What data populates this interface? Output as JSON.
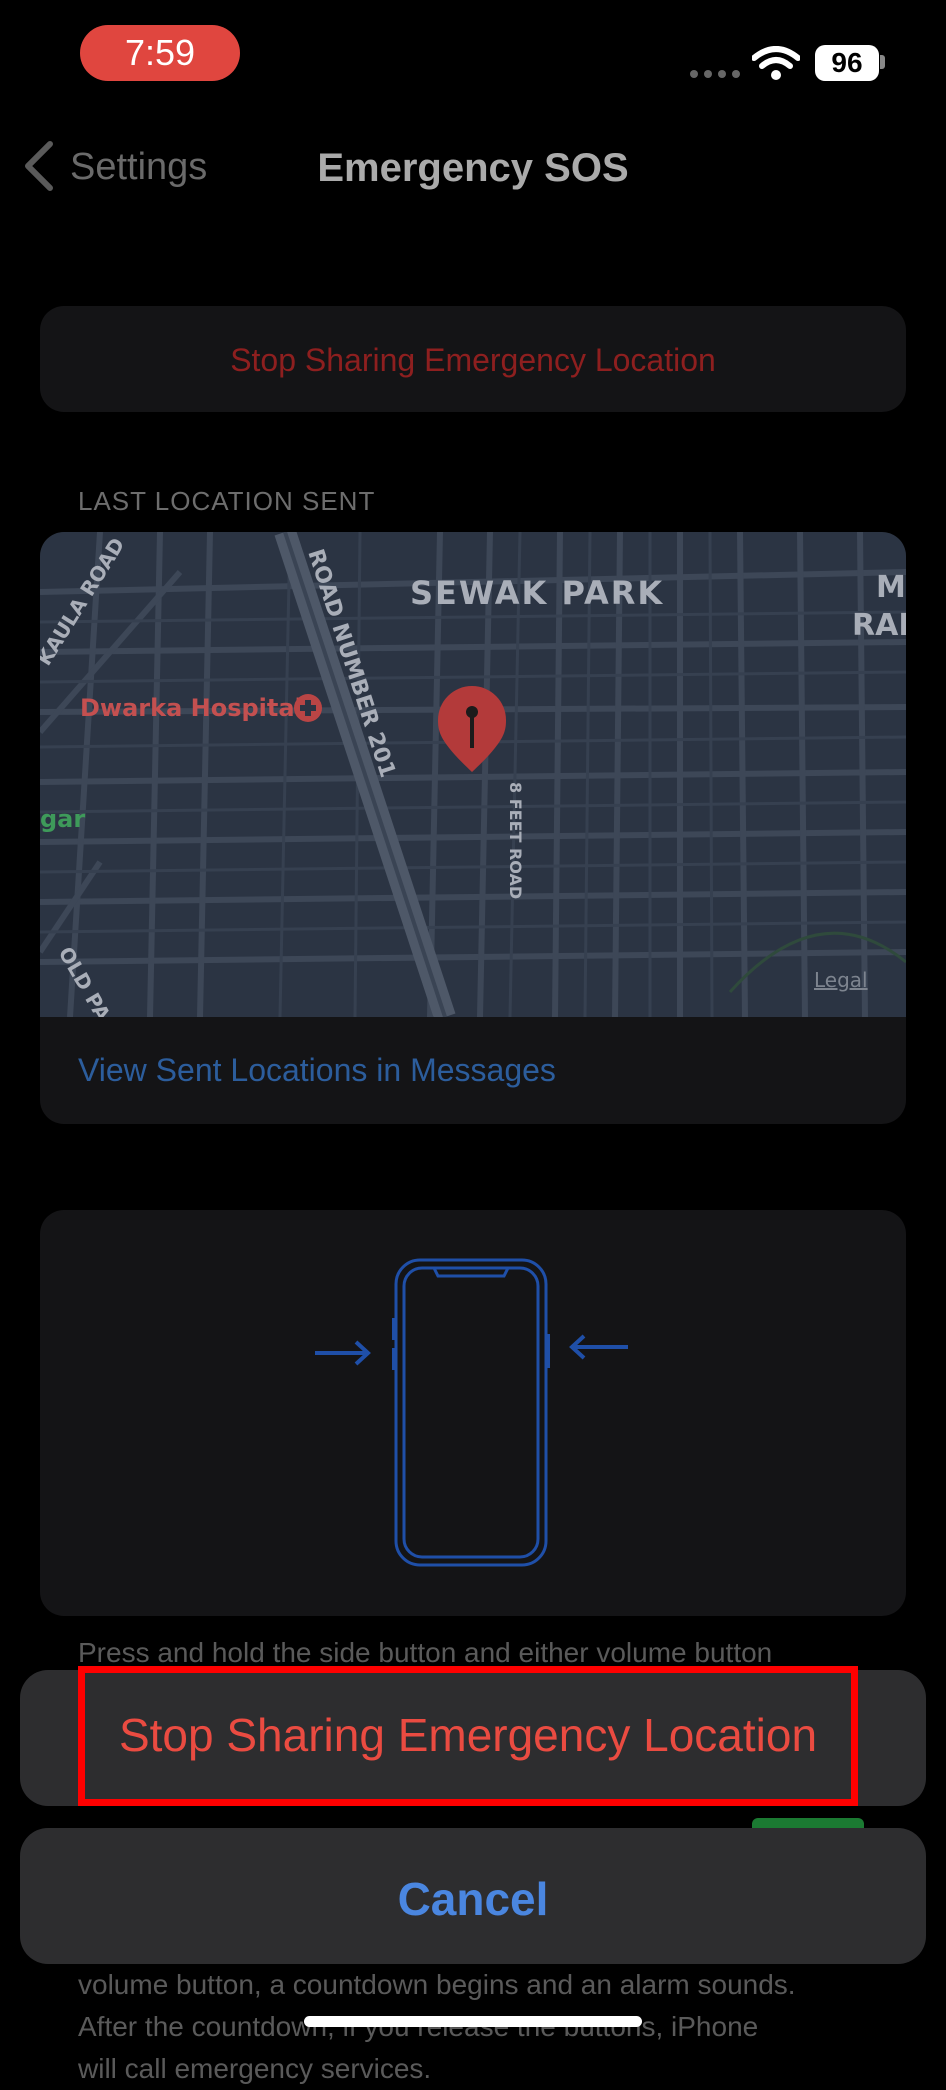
{
  "status_bar": {
    "time": "7:59",
    "battery": "96",
    "wifi_icon": "wifi-icon"
  },
  "nav": {
    "back_label": "Settings",
    "title": "Emergency SOS"
  },
  "stop_sharing_row": {
    "label": "Stop Sharing Emergency Location"
  },
  "last_location": {
    "header": "LAST LOCATION SENT",
    "map": {
      "labels": {
        "sewak_park": "SEWAK PARK",
        "dwarka_hospital": "Dwarka Hospital",
        "road_201": "ROAD NUMBER 201",
        "feet_road": "8 FEET ROAD",
        "kaula_road": "KAULA ROAD",
        "old_pa": "OLD PA",
        "gar": "gar",
        "ma": "MA",
        "ram": "RAM",
        "legal": "Legal"
      }
    },
    "view_link": "View Sent Locations in Messages"
  },
  "footer": {
    "line1": "Press and hold the side button and either volume button",
    "line2": "volume button, a countdown begins and an alarm sounds.",
    "line3": "After the countdown, if you release the buttons, iPhone",
    "line4": "will call emergency services."
  },
  "action_sheet": {
    "action_label": "Stop Sharing Emergency Location",
    "cancel_label": "Cancel",
    "action_color": "#ea4b41",
    "cancel_color": "#4a86e0"
  }
}
